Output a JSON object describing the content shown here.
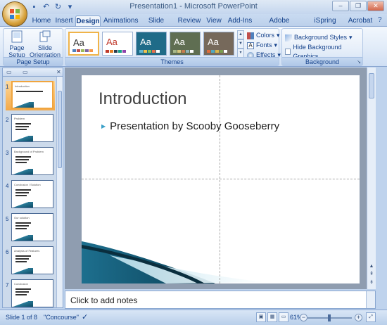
{
  "window": {
    "title": "Presentation1 - Microsoft PowerPoint",
    "controls": {
      "minimize": "–",
      "restore": "❐",
      "close": "✕"
    }
  },
  "qat": {
    "save_icon": "save-icon",
    "undo_icon": "undo-icon",
    "redo_icon": "redo-icon",
    "customize_icon": "chevron-down-icon"
  },
  "tabs": [
    {
      "label": "Home"
    },
    {
      "label": "Insert"
    },
    {
      "label": "Design",
      "active": true
    },
    {
      "label": "Animations"
    },
    {
      "label": "Slide Show"
    },
    {
      "label": "Review"
    },
    {
      "label": "View"
    },
    {
      "label": "Add-Ins"
    },
    {
      "label": "Adobe Presenter"
    },
    {
      "label": "iSpring Free"
    },
    {
      "label": "Acrobat"
    }
  ],
  "ribbon": {
    "page_setup": {
      "label": "Page Setup",
      "page_setup_btn": "Page Setup",
      "orientation_btn": "Slide Orientation"
    },
    "themes": {
      "label": "Themes",
      "thumbs": [
        {
          "text": "Aa",
          "bg": "#ffffff",
          "fg": "#333333",
          "swatches": [
            "#4f81bd",
            "#c0504d",
            "#9bbb59",
            "#8064a2",
            "#f79646"
          ],
          "selected": true
        },
        {
          "text": "Aa",
          "bg": "#ffffff",
          "fg": "#c0392b",
          "swatches": [
            "#c0392b",
            "#e67e22",
            "#2c3e50",
            "#16a085",
            "#8e44ad"
          ]
        },
        {
          "text": "Aa",
          "bg": "#1f6b88",
          "fg": "#ffffff",
          "swatches": [
            "#62b7d3",
            "#f2c14e",
            "#88c057",
            "#e86f4c",
            "#ffffff"
          ]
        },
        {
          "text": "Aa",
          "bg": "#5f6e52",
          "fg": "#ffffff",
          "swatches": [
            "#a9b98a",
            "#d6c77d",
            "#c67c4e",
            "#8fb3b5",
            "#ffffff"
          ]
        },
        {
          "text": "Aa",
          "bg": "#76695b",
          "fg": "#ffffff",
          "swatches": [
            "#e06c3c",
            "#4fa9c1",
            "#d9b64c",
            "#7b9e4f",
            "#ffffff"
          ]
        }
      ],
      "colors": "Colors",
      "fonts": "Fonts",
      "effects": "Effects"
    },
    "background": {
      "label": "Background",
      "styles": "Background Styles",
      "hide": "Hide Background Graphics"
    }
  },
  "slides": [
    {
      "num": "1",
      "title": "Introduction",
      "active": true
    },
    {
      "num": "2",
      "title": "Problem"
    },
    {
      "num": "3",
      "title": "Background of Problem"
    },
    {
      "num": "4",
      "title": "Conclusion / Solution"
    },
    {
      "num": "5",
      "title": "Our solution"
    },
    {
      "num": "6",
      "title": "Analysis of Features"
    },
    {
      "num": "7",
      "title": "Conclusion"
    }
  ],
  "slide": {
    "title": "Introduction",
    "bullet": "Presentation by Scooby Gooseberry"
  },
  "notes": {
    "placeholder": "Click to add notes"
  },
  "status": {
    "slide": "Slide 1 of 8",
    "theme": "\"Concourse\"",
    "zoom": "61%",
    "zoom_value": 0.61
  }
}
